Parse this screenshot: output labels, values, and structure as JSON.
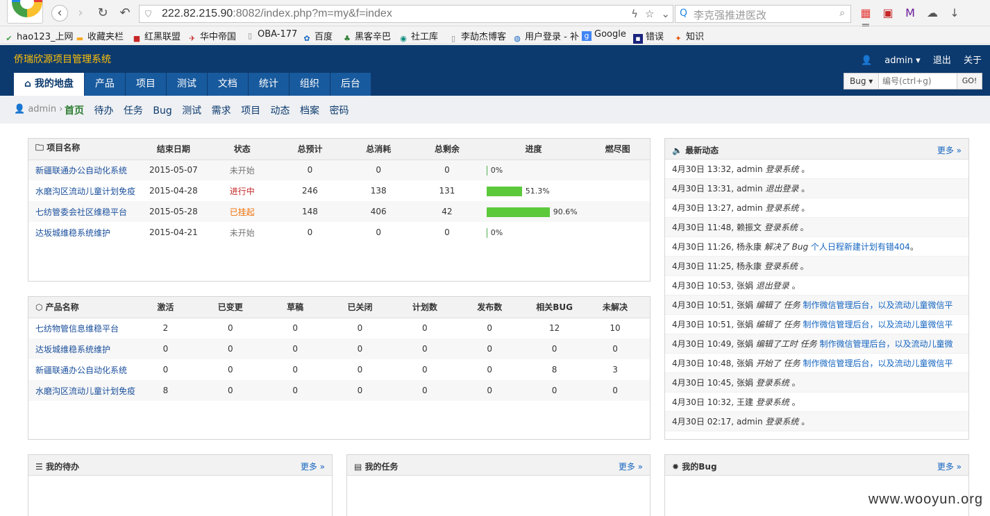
{
  "browser": {
    "url_host": "222.82.215.90",
    "url_rest": ":8082/index.php?m=my&f=index",
    "search_placeholder": "李克强推进医改"
  },
  "bookmarks": [
    {
      "label": "hao123_上网"
    },
    {
      "label": "收藏夹栏"
    },
    {
      "label": "红黑联盟"
    },
    {
      "label": "华中帝国"
    },
    {
      "label": "OBA-177"
    },
    {
      "label": "百度"
    },
    {
      "label": "黑客辛巴"
    },
    {
      "label": "社工库"
    },
    {
      "label": "李劼杰博客"
    },
    {
      "label": "用户登录 - 补"
    },
    {
      "label": "Google"
    },
    {
      "label": "错误"
    },
    {
      "label": "知识"
    }
  ],
  "app": {
    "title": "侨瑞欣源项目管理系统",
    "user": "admin",
    "logout": "退出",
    "about": "关于",
    "nav": [
      "我的地盘",
      "产品",
      "项目",
      "测试",
      "文档",
      "统计",
      "组织",
      "后台"
    ],
    "quick_type": "Bug",
    "quick_placeholder": "编号(ctrl+g)",
    "go_label": "GO!"
  },
  "subnav": {
    "crumb": "admin",
    "links": [
      "首页",
      "待办",
      "任务",
      "Bug",
      "测试",
      "需求",
      "项目",
      "动态",
      "档案",
      "密码"
    ]
  },
  "projects": {
    "headers": [
      "项目名称",
      "结束日期",
      "状态",
      "总预计",
      "总消耗",
      "总剩余",
      "进度",
      "燃尽图"
    ],
    "rows": [
      {
        "name": "新疆联通办公自动化系统",
        "end": "2015-05-07",
        "status": "未开始",
        "est": "0",
        "consumed": "0",
        "left": "0",
        "progress": 0,
        "progress_label": "0%"
      },
      {
        "name": "水磨沟区流动儿童计划免疫",
        "end": "2015-04-28",
        "status": "进行中",
        "est": "246",
        "consumed": "138",
        "left": "131",
        "progress": 51.3,
        "progress_label": "51.3%"
      },
      {
        "name": "七纺管委会社区维稳平台",
        "end": "2015-05-28",
        "status": "已挂起",
        "est": "148",
        "consumed": "406",
        "left": "42",
        "progress": 90.6,
        "progress_label": "90.6%"
      },
      {
        "name": "达坂城维稳系统维护",
        "end": "2015-04-21",
        "status": "未开始",
        "est": "0",
        "consumed": "0",
        "left": "0",
        "progress": 0,
        "progress_label": "0%"
      }
    ]
  },
  "products": {
    "headers": [
      "产品名称",
      "激活",
      "已变更",
      "草稿",
      "已关闭",
      "计划数",
      "发布数",
      "相关BUG",
      "未解决"
    ],
    "rows": [
      {
        "name": "七纺物管信息维稳平台",
        "vals": [
          "2",
          "0",
          "0",
          "0",
          "0",
          "0",
          "12",
          "10"
        ]
      },
      {
        "name": "达坂城维稳系统维护",
        "vals": [
          "0",
          "0",
          "0",
          "0",
          "0",
          "0",
          "0",
          "0"
        ]
      },
      {
        "name": "新疆联通办公自动化系统",
        "vals": [
          "0",
          "0",
          "0",
          "0",
          "0",
          "0",
          "8",
          "3"
        ]
      },
      {
        "name": "水磨沟区流动儿童计划免疫",
        "vals": [
          "8",
          "0",
          "0",
          "0",
          "0",
          "0",
          "0",
          "0"
        ]
      }
    ]
  },
  "feed": {
    "title": "最新动态",
    "more": "更多",
    "items": [
      {
        "time": "4月30日 13:32,",
        "user": "admin",
        "action": "登录系统",
        "obj": "",
        "suffix": "。"
      },
      {
        "time": "4月30日 13:31,",
        "user": "admin",
        "action": "退出登录",
        "obj": "",
        "suffix": "。"
      },
      {
        "time": "4月30日 13:27,",
        "user": "admin",
        "action": "登录系统",
        "obj": "",
        "suffix": "。"
      },
      {
        "time": "4月30日 11:48,",
        "user": "赖振文",
        "action": "登录系统",
        "obj": "",
        "suffix": "。"
      },
      {
        "time": "4月30日 11:26,",
        "user": "杨永康",
        "action": "解决了 Bug",
        "obj": "个人日程新建计划有错404",
        "suffix": "。"
      },
      {
        "time": "4月30日 11:25,",
        "user": "杨永康",
        "action": "登录系统",
        "obj": "",
        "suffix": "。"
      },
      {
        "time": "4月30日 10:53,",
        "user": "张娟",
        "action": "退出登录",
        "obj": "",
        "suffix": "。"
      },
      {
        "time": "4月30日 10:51,",
        "user": "张娟",
        "action": "编辑了 任务",
        "obj": "制作微信管理后台，以及流动儿童微信平",
        "suffix": ""
      },
      {
        "time": "4月30日 10:51,",
        "user": "张娟",
        "action": "编辑了 任务",
        "obj": "制作微信管理后台，以及流动儿童微信平",
        "suffix": ""
      },
      {
        "time": "4月30日 10:49,",
        "user": "张娟",
        "action": "编辑了工时 任务",
        "obj": "制作微信管理后台，以及流动儿童微",
        "suffix": ""
      },
      {
        "time": "4月30日 10:48,",
        "user": "张娟",
        "action": "开始了 任务",
        "obj": "制作微信管理后台，以及流动儿童微信平",
        "suffix": ""
      },
      {
        "time": "4月30日 10:45,",
        "user": "张娟",
        "action": "登录系统",
        "obj": "",
        "suffix": "。"
      },
      {
        "time": "4月30日 10:32,",
        "user": "王建",
        "action": "登录系统",
        "obj": "",
        "suffix": "。"
      },
      {
        "time": "4月30日 02:17,",
        "user": "admin",
        "action": "登录系统",
        "obj": "",
        "suffix": "。"
      }
    ]
  },
  "widgets": {
    "todo_title": "我的待办",
    "task_title": "我的任务",
    "bug_title": "我的Bug",
    "more": "更多"
  },
  "watermark": "www.wooyun.org",
  "colors": {
    "header_bg": "#0d3a6e",
    "nav_tab": "#185a9e",
    "title_accent": "#ffc107",
    "progress_fill": "#5cc93b"
  }
}
